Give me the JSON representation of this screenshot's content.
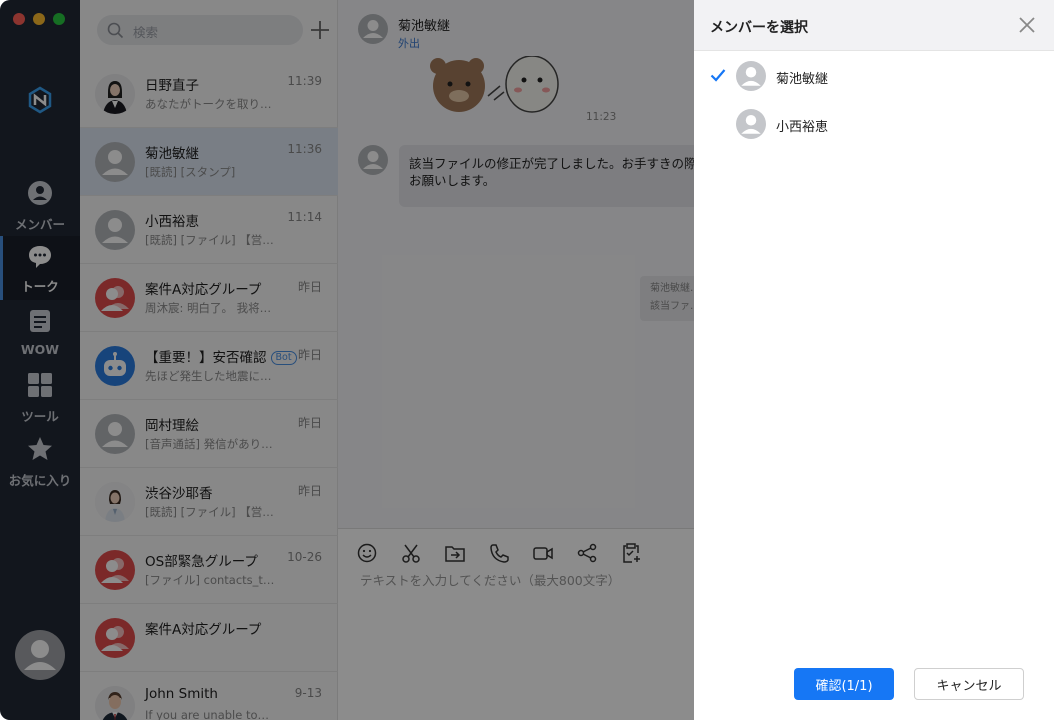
{
  "window": {
    "traffic_colors": [
      "#ff5f57",
      "#febc2e",
      "#28c840"
    ]
  },
  "nav": {
    "items": [
      {
        "label": "メンバー",
        "icon": "person-circle-icon"
      },
      {
        "label": "トーク",
        "icon": "chat-bubble-icon"
      },
      {
        "label": "WOW",
        "icon": "note-icon"
      },
      {
        "label": "ツール",
        "icon": "grid-icon"
      },
      {
        "label": "お気に入り",
        "icon": "star-icon"
      }
    ],
    "active_index": 1
  },
  "search": {
    "placeholder": "検索"
  },
  "conversations": [
    {
      "name": "日野直子",
      "time": "11:39",
      "preview": "あなたがトークを取り…",
      "avatar": "photo-woman"
    },
    {
      "name": "菊池敏継",
      "time": "11:36",
      "preview": "[既読] [スタンプ]",
      "avatar": "gray",
      "selected": true
    },
    {
      "name": "小西裕恵",
      "time": "11:14",
      "preview": "[既読] [ファイル] 【営…",
      "avatar": "gray"
    },
    {
      "name": "案件A対応グループ",
      "time": "昨日",
      "preview": "周沐宸: 明白了。 我将…",
      "avatar": "red-group"
    },
    {
      "name": "【重要！】安否確認",
      "badge": "Bot",
      "time": "昨日",
      "preview": "先ほど発生した地震に…",
      "avatar": "blue-bot"
    },
    {
      "name": "岡村理絵",
      "time": "昨日",
      "preview": "[音声通話] 発信があり…",
      "avatar": "gray"
    },
    {
      "name": "渋谷沙耶香",
      "time": "昨日",
      "preview": "[既読] [ファイル] 【営…",
      "avatar": "photo-woman2"
    },
    {
      "name": "OS部緊急グループ",
      "time": "10-26",
      "preview": "[ファイル] contacts_t…",
      "avatar": "red-group"
    },
    {
      "name": "案件A対応グループ",
      "time": "",
      "preview": "",
      "avatar": "red-group"
    },
    {
      "name": "John Smith",
      "time": "9-13",
      "preview": "If you are unable to…",
      "avatar": "photo-man"
    }
  ],
  "chat": {
    "contact_name": "菊池敏継",
    "contact_status": "外出",
    "sticker_time": "11:23",
    "message": "該当ファイルの修正が完了しました。お手すきの際にご確認お願いします。",
    "message_line1": "該当ファイルの修正が完了しました。お手すきの際に",
    "message_line2": "お願いします。",
    "sys_line1": "菊池敏継…",
    "sys_line2": "該当ファ…",
    "input_placeholder": "テキストを入力してください（最大800文字）"
  },
  "panel": {
    "title": "メンバーを選択",
    "members": [
      {
        "name": "菊池敏継",
        "checked": true
      },
      {
        "name": "小西裕恵",
        "checked": false
      }
    ],
    "confirm_label": "確認(1/1)",
    "cancel_label": "キャンセル"
  }
}
